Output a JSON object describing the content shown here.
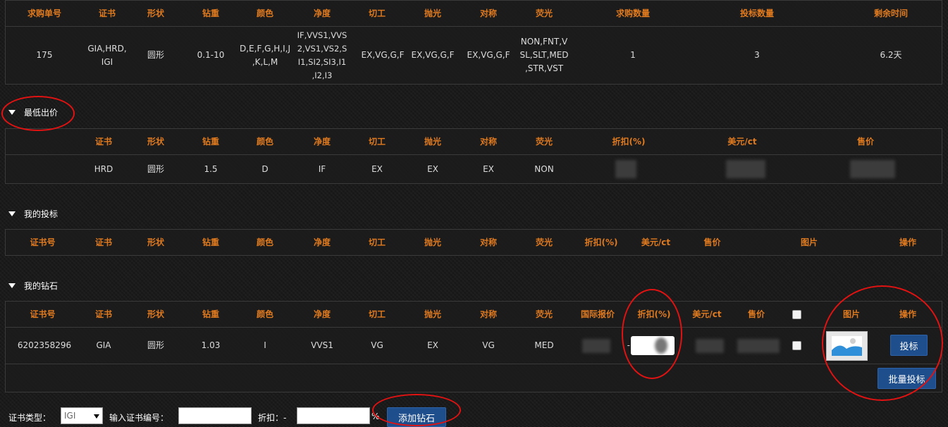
{
  "request_table": {
    "headers": [
      "求购单号",
      "证书",
      "形状",
      "钻重",
      "颜色",
      "净度",
      "切工",
      "抛光",
      "对称",
      "荧光",
      "求购数量",
      "投标数量",
      "剩余时间"
    ],
    "row": [
      "175",
      "GIA,HRD,\nIGI",
      "圆形",
      "0.1-10",
      "D,E,F,G,H,I,J\n,K,L,M",
      "IF,VVS1,VVS\n2,VS1,VS2,S\nI1,SI2,SI3,I1\n,I2,I3",
      "EX,VG,G,F",
      "EX,VG,G,F",
      "EX,VG,G,F",
      "NON,FNT,V\nSL,SLT,MED\n,STR,VST",
      "1",
      "3",
      "6.2天"
    ]
  },
  "lowest_bid": {
    "title": "最低出价",
    "headers": [
      "证书",
      "形状",
      "钻重",
      "颜色",
      "净度",
      "切工",
      "抛光",
      "对称",
      "荧光",
      "折扣(%)",
      "美元/ct",
      "售价"
    ],
    "row": [
      "HRD",
      "圆形",
      "1.5",
      "D",
      "IF",
      "EX",
      "EX",
      "EX",
      "NON"
    ]
  },
  "my_bids": {
    "title": "我的投标",
    "headers": [
      "证书号",
      "证书",
      "形状",
      "钻重",
      "颜色",
      "净度",
      "切工",
      "抛光",
      "对称",
      "荧光",
      "折扣(%)",
      "美元/ct",
      "售价",
      "图片",
      "操作"
    ]
  },
  "my_diamonds": {
    "title": "我的钻石",
    "headers": [
      "证书号",
      "证书",
      "形状",
      "钻重",
      "颜色",
      "净度",
      "切工",
      "抛光",
      "对称",
      "荧光",
      "国际报价",
      "折扣(%)",
      "美元/ct",
      "售价",
      "图片",
      "操作"
    ],
    "row": [
      "6202358296",
      "GIA",
      "圆形",
      "1.03",
      "I",
      "VVS1",
      "VG",
      "EX",
      "VG",
      "MED"
    ],
    "discount_prefix": "-",
    "bid_button": "投标",
    "batch_button": "批量投标",
    "image_icon": "image-placeholder-icon"
  },
  "add_form": {
    "cert_type_label": "证书类型：",
    "cert_type_value": "IGI",
    "cert_no_label": "输入证书编号：",
    "discount_label": "折扣：-",
    "percent": "%",
    "add_button": "添加钻石"
  },
  "colors": {
    "header_text": "#e07a1f",
    "button": "#1f4e8c",
    "annotation": "#e01212"
  }
}
